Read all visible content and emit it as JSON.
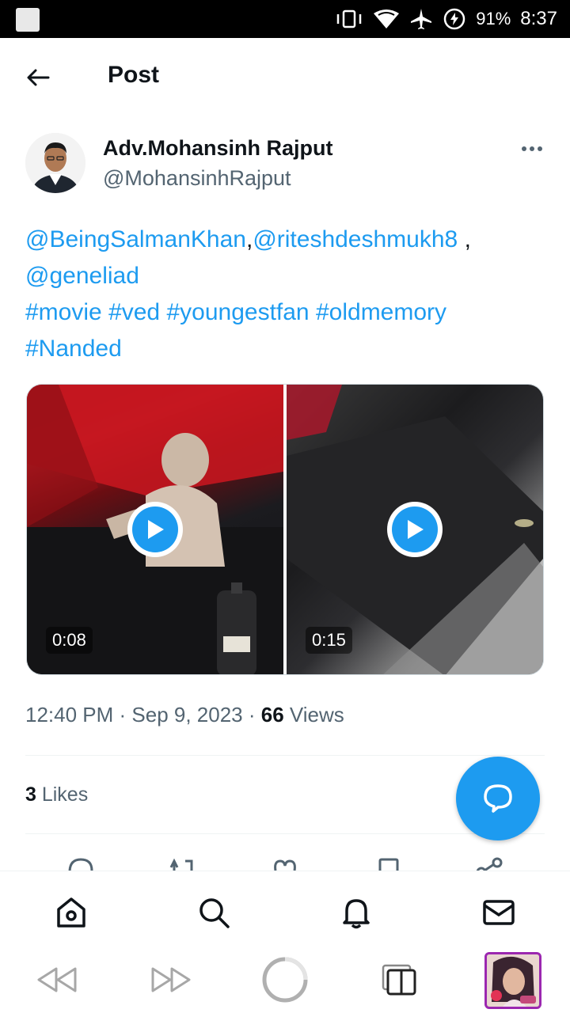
{
  "status_bar": {
    "battery": "91%",
    "time": "8:37"
  },
  "header": {
    "title": "Post"
  },
  "author": {
    "name": "Adv.Mohansinh Rajput",
    "handle": "@MohansinhRajput"
  },
  "tweet": {
    "mention1": "@BeingSalmanKhan",
    "sep1": ",",
    "mention2": "@riteshdeshmukh8",
    "sep2": " ,",
    "mention3": "@geneliad",
    "tag1": "#movie",
    "tag2": "#ved",
    "tag3": "#youngestfan",
    "tag4": "#oldmemory",
    "tag5": "#Nanded"
  },
  "media": [
    {
      "duration": "0:08"
    },
    {
      "duration": "0:15"
    }
  ],
  "meta": {
    "time": "12:40 PM",
    "dot1": " · ",
    "date": "Sep 9, 2023",
    "dot2": " · ",
    "views_count": "66",
    "views_label": " Views"
  },
  "likes": {
    "count": "3",
    "label": " Likes"
  },
  "colors": {
    "accent": "#1d9bf0",
    "text": "#0f1419",
    "muted": "#536471"
  },
  "icons": {
    "back": "arrow-left-icon",
    "more": "more-horizontal-icon",
    "fab": "reply-bubble-icon",
    "nav": [
      "home-icon",
      "search-icon",
      "bell-icon",
      "mail-icon"
    ],
    "system": [
      "rewind-icon",
      "fast-forward-icon",
      "loading-circle-icon",
      "tabs-icon",
      "profile-thumbnail"
    ]
  }
}
